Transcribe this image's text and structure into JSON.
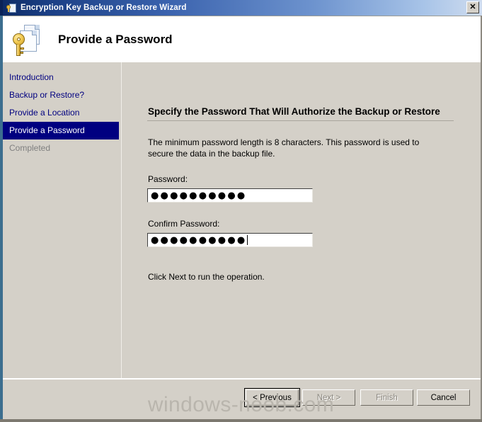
{
  "window": {
    "title": "Encryption Key Backup or Restore Wizard",
    "title_icon": "key-document-icon",
    "close_label": "✕",
    "accent_title_start": "#0c2a64",
    "accent_title_end": "#cfdcef",
    "dialog_background": "#d4d0c8",
    "highlight_color": "#000080",
    "link_color": "#000080",
    "disabled_color": "#808080"
  },
  "header": {
    "title": "Provide a Password",
    "icon": "gold-key-with-pages-icon"
  },
  "sidebar": {
    "items": [
      {
        "label": "Introduction",
        "state": "link"
      },
      {
        "label": "Backup or Restore?",
        "state": "link"
      },
      {
        "label": "Provide a Location",
        "state": "link"
      },
      {
        "label": "Provide a Password",
        "state": "active"
      },
      {
        "label": "Completed",
        "state": "disabled"
      }
    ]
  },
  "main": {
    "heading": "Specify the Password That Will Authorize the Backup or Restore",
    "description": "The minimum password length is 8 characters.  This password is used to secure the data in the backup file.",
    "password": {
      "label": "Password:",
      "value": "●●●●●●●●●●",
      "placeholder": "",
      "focused": false
    },
    "confirm_password": {
      "label": "Confirm Password:",
      "value": "●●●●●●●●●●",
      "placeholder": "",
      "focused": true
    },
    "footnote": "Click Next to run the operation."
  },
  "footer": {
    "buttons": [
      {
        "label": "< Previous",
        "enabled": true,
        "focused": true
      },
      {
        "label": "Next >",
        "enabled": false,
        "focused": false
      },
      {
        "label": "Finish",
        "enabled": false,
        "focused": false
      },
      {
        "label": "Cancel",
        "enabled": true,
        "focused": false
      }
    ]
  },
  "watermark": {
    "text": "windows-noob.com"
  }
}
